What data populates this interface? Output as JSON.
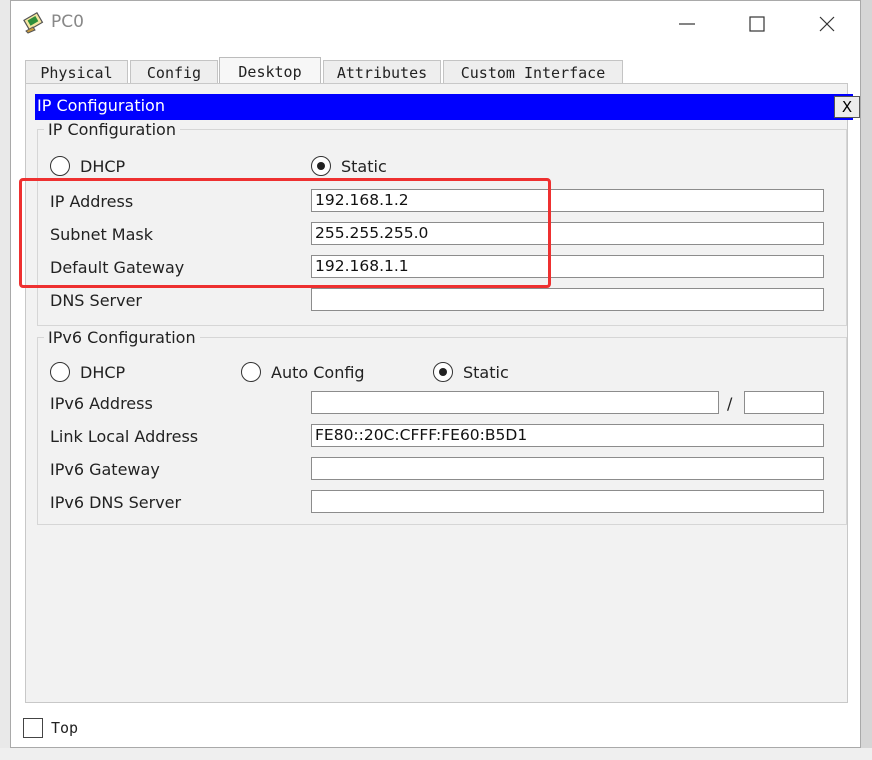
{
  "window": {
    "title": "PC0",
    "icon": "pc-device-icon"
  },
  "tabs": [
    {
      "label": "Physical"
    },
    {
      "label": "Config"
    },
    {
      "label": "Desktop",
      "active": true
    },
    {
      "label": "Attributes"
    },
    {
      "label": "Custom Interface"
    }
  ],
  "ip_config": {
    "header_title": "IP Configuration",
    "close_label": "X",
    "ipv4": {
      "legend": "IP Configuration",
      "dhcp_label": "DHCP",
      "static_label": "Static",
      "selected": "Static",
      "ip_address_label": "IP Address",
      "ip_address_value": "192.168.1.2",
      "subnet_mask_label": "Subnet Mask",
      "subnet_mask_value": "255.255.255.0",
      "gateway_label": "Default Gateway",
      "gateway_value": "192.168.1.1",
      "dns_label": "DNS Server",
      "dns_value": ""
    },
    "ipv6": {
      "legend": "IPv6 Configuration",
      "dhcp_label": "DHCP",
      "auto_label": "Auto Config",
      "static_label": "Static",
      "selected": "Static",
      "address_label": "IPv6 Address",
      "address_value": "",
      "prefix_separator": "/",
      "prefix_value": "",
      "link_local_label": "Link Local Address",
      "link_local_value": "FE80::20C:CFFF:FE60:B5D1",
      "gateway_label": "IPv6 Gateway",
      "gateway_value": "",
      "dns_label": "IPv6 DNS Server",
      "dns_value": ""
    }
  },
  "footer": {
    "top_label": "Top",
    "top_checked": false
  },
  "colors": {
    "header_blue": "#0000ff",
    "highlight_red": "#ee3030"
  }
}
